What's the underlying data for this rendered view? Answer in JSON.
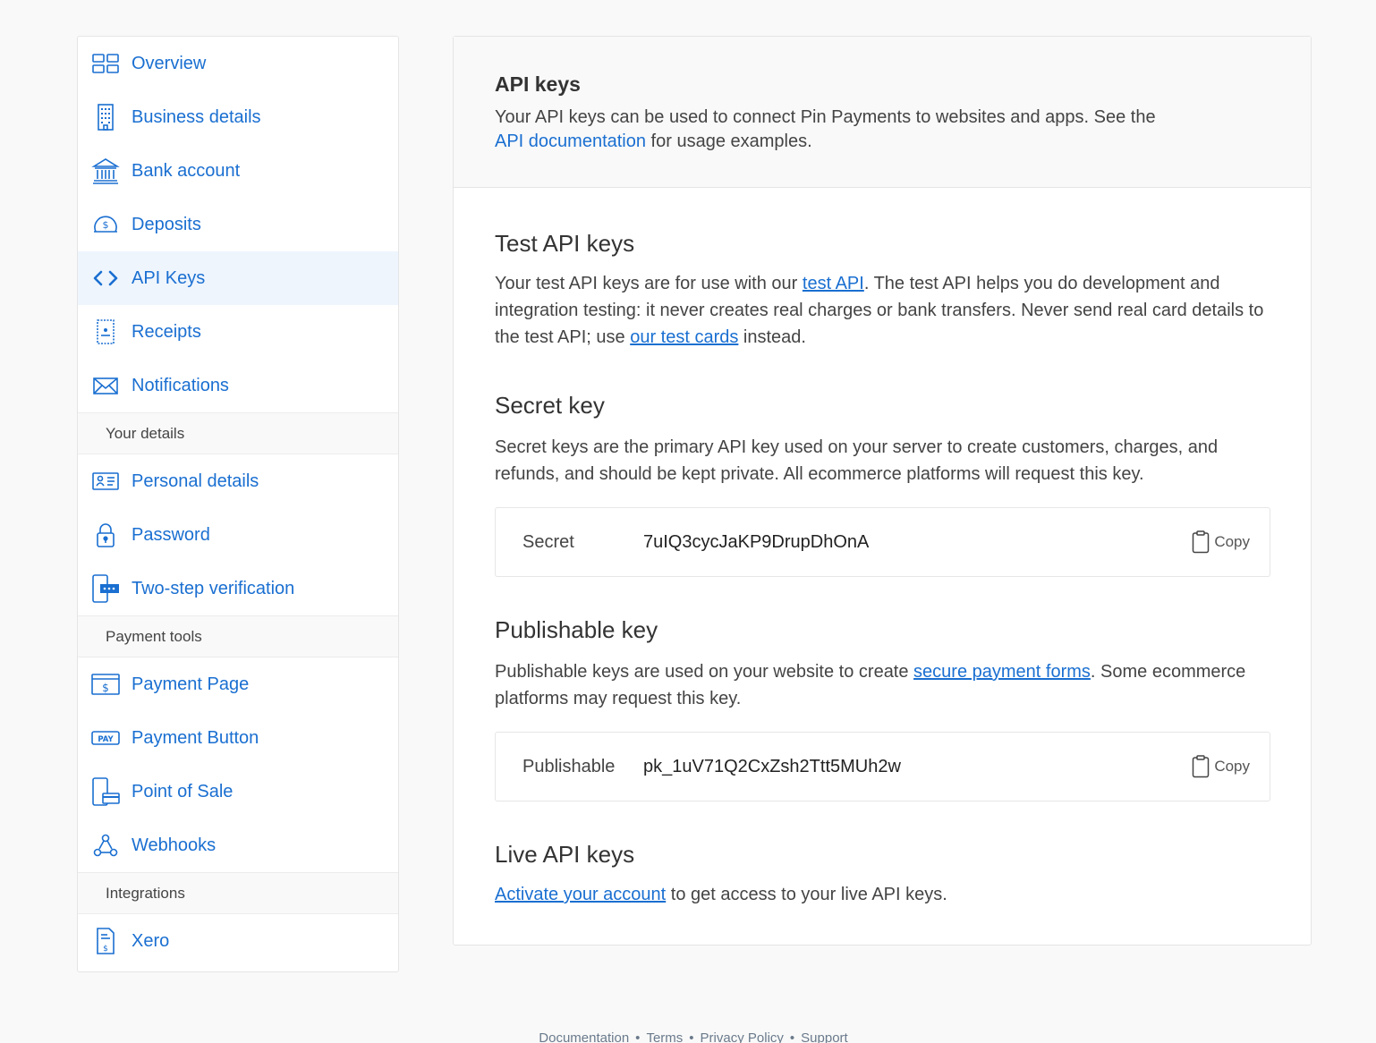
{
  "sidebar": {
    "group1": [
      {
        "label": "Overview",
        "icon": "grid-icon"
      },
      {
        "label": "Business details",
        "icon": "building-icon"
      },
      {
        "label": "Bank account",
        "icon": "bank-icon"
      },
      {
        "label": "Deposits",
        "icon": "money-icon"
      },
      {
        "label": "API Keys",
        "icon": "code-icon",
        "active": true
      },
      {
        "label": "Receipts",
        "icon": "receipt-icon"
      },
      {
        "label": "Notifications",
        "icon": "envelope-icon"
      }
    ],
    "section_your_details": "Your details",
    "group2": [
      {
        "label": "Personal details",
        "icon": "id-card-icon"
      },
      {
        "label": "Password",
        "icon": "lock-icon"
      },
      {
        "label": "Two-step verification",
        "icon": "phone-code-icon"
      }
    ],
    "section_payment_tools": "Payment tools",
    "group3": [
      {
        "label": "Payment Page",
        "icon": "payment-page-icon"
      },
      {
        "label": "Payment Button",
        "icon": "pay-button-icon"
      },
      {
        "label": "Point of Sale",
        "icon": "pos-icon"
      },
      {
        "label": "Webhooks",
        "icon": "webhook-icon"
      }
    ],
    "section_integrations": "Integrations",
    "group4": [
      {
        "label": "Xero",
        "icon": "invoice-icon"
      }
    ]
  },
  "header": {
    "title": "API keys",
    "desc_before": "Your API keys can be used to connect Pin Payments to websites and apps. See the",
    "desc_link": "API documentation",
    "desc_after": " for usage examples."
  },
  "test": {
    "title": "Test API keys",
    "p1": "Your test API keys are for use with our ",
    "link1": "test API",
    "p2": ". The test API helps you do development and integration testing: it never creates real charges or bank transfers. Never send real card details to the test API; use ",
    "link2": "our test cards",
    "p3": " instead."
  },
  "secret": {
    "title": "Secret key",
    "desc": "Secret keys are the primary API key used on your server to create customers, charges, and refunds, and should be kept private. All ecommerce platforms will request this key.",
    "label": "Secret",
    "value": "7uIQ3cycJaKP9DrupDhOnA",
    "copy": "Copy"
  },
  "publishable": {
    "title": "Publishable key",
    "p1": "Publishable keys are used on your website to create ",
    "link": "secure payment forms",
    "p2": ". Some ecommerce platforms may request this key.",
    "label": "Publishable",
    "value": "pk_1uV71Q2CxZsh2Ttt5MUh2w",
    "copy": "Copy"
  },
  "live": {
    "title": "Live API keys",
    "link": "Activate your account",
    "after": " to get access to your live API keys."
  },
  "footer": {
    "links": [
      "Documentation",
      "Terms",
      "Privacy Policy",
      "Support"
    ],
    "separator": "•"
  },
  "colors": {
    "accent": "#1a6fd1",
    "active_bg": "#eef5fd",
    "page_bg": "#f9f9f9"
  }
}
